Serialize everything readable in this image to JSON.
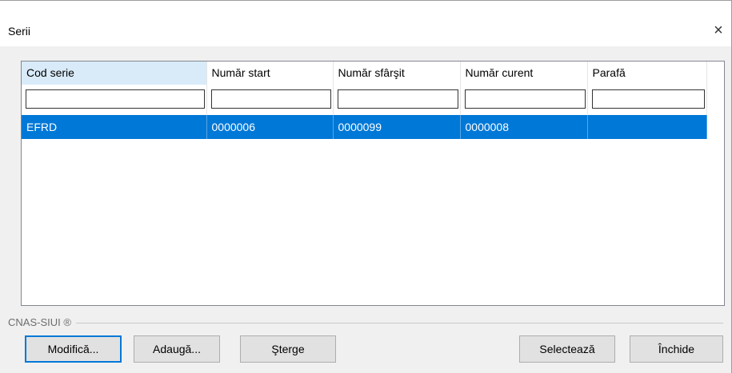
{
  "window": {
    "title": "Serii",
    "close_glyph": "×"
  },
  "grid": {
    "columns": [
      {
        "label": "Cod serie"
      },
      {
        "label": "Număr start"
      },
      {
        "label": "Număr sfârşit"
      },
      {
        "label": "Număr curent"
      },
      {
        "label": "Parafă"
      }
    ],
    "filters": [
      "",
      "",
      "",
      "",
      ""
    ],
    "rows": [
      {
        "cod_serie": "EFRD",
        "numar_start": "0000006",
        "numar_sfarsit": "0000099",
        "numar_curent": "0000008",
        "parafa": ""
      }
    ]
  },
  "footer": {
    "label": "CNAS-SIUI ®"
  },
  "buttons": {
    "modifica": "Modifică...",
    "adauga": "Adaugă...",
    "sterge": "Şterge",
    "selecteaza": "Selectează",
    "inchide": "Închide"
  },
  "colors": {
    "selection": "#0078d7",
    "sorted_header": "#d9ebf9"
  }
}
